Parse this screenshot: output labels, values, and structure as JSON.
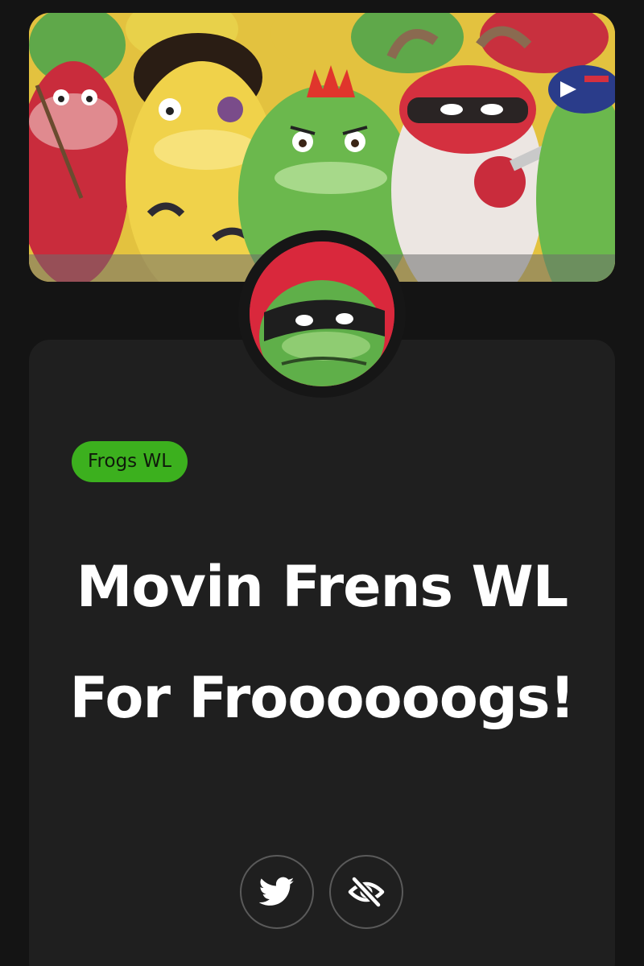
{
  "banner": {
    "icon": "frog-crowd-illustration"
  },
  "profile": {
    "avatar_icon": "masked-frog-avatar"
  },
  "tag": {
    "label": "Frogs WL",
    "color": "#3cb01e"
  },
  "post": {
    "title": "Movin Frens WL For Froooooogs!"
  },
  "actions": [
    {
      "icon": "twitter-icon"
    },
    {
      "icon": "eye-off-icon"
    }
  ],
  "colors": {
    "background": "#141414",
    "card": "#1f1f1f",
    "accent": "#3cb01e",
    "avatar_ring": "#d9283c"
  }
}
